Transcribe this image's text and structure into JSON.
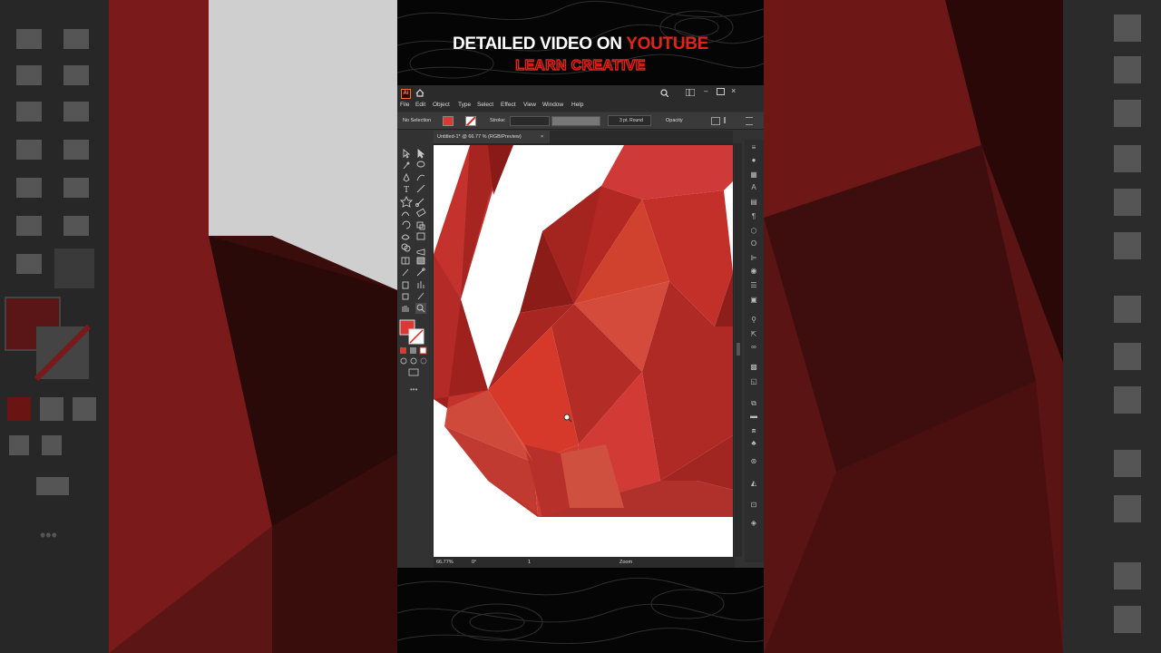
{
  "banner": {
    "line1_part1": "DETAILED VIDEO ON",
    "line1_part2": "YOUTUBE",
    "line2": "LEARN CREATIVE"
  },
  "app": {
    "logo": "Ai",
    "menu": [
      "File",
      "Edit",
      "Object",
      "Type",
      "Select",
      "Effect",
      "View",
      "Window",
      "Help"
    ],
    "control_bar": {
      "selection_status": "No Selection",
      "stroke_label": "Stroke:",
      "brush_label": "3 pt. Round",
      "opacity_label": "Opacity"
    },
    "document_tab": {
      "title": "Untitled-1* @ 66.77 % (RGB/Preview)",
      "close": "×"
    },
    "status_bar": {
      "zoom": "66.77%",
      "rotation": "0°",
      "artboard_num": "1",
      "tool_name": "Zoom"
    }
  },
  "colors": {
    "accent_red": "#e2231a",
    "fill_swatch": "#d93a35",
    "ui_dark": "#323232"
  },
  "icons": [
    "home-icon",
    "search-icon",
    "arrange-icon",
    "minimize-icon",
    "maximize-icon",
    "close-icon",
    "selection-tool-icon",
    "direct-selection-icon",
    "magic-wand-icon",
    "lasso-icon",
    "pen-icon",
    "curvature-icon",
    "type-icon",
    "line-icon",
    "rectangle-icon",
    "paintbrush-icon",
    "shaper-icon",
    "eraser-icon",
    "rotate-icon",
    "scale-icon",
    "width-icon",
    "free-transform-icon",
    "shape-builder-icon",
    "perspective-icon",
    "mesh-icon",
    "gradient-icon",
    "eyedropper-icon",
    "blend-icon",
    "symbol-sprayer-icon",
    "graph-icon",
    "artboard-tool-icon",
    "slice-icon",
    "hand-icon",
    "zoom-icon",
    "more-tools-icon"
  ]
}
